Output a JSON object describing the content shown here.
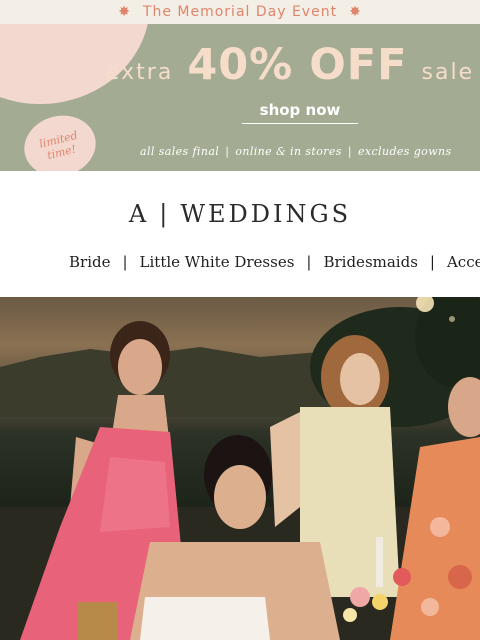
{
  "event_bar": {
    "text": "The Memorial Day Event",
    "star_icon": "sparkle-icon"
  },
  "promo": {
    "offer_prefix": "extra",
    "offer_main": "40% OFF",
    "offer_suffix": "sale",
    "cta_label": "shop now",
    "badge_text": "limited time!",
    "terms": [
      "all sales final",
      "online & in stores",
      "excludes gowns"
    ],
    "colors": {
      "banner_bg": "#a3ab93",
      "accent_peach": "#f6ddc9",
      "badge_pink": "#f3d8cf",
      "coral": "#e0846b"
    }
  },
  "header": {
    "brand_letter": "A",
    "brand_name": "WEDDINGS"
  },
  "nav": {
    "items": [
      "Bride",
      "Little White Dresses",
      "Bridesmaids",
      "Acce"
    ]
  },
  "hero": {
    "description_icon": "hero-photo"
  }
}
